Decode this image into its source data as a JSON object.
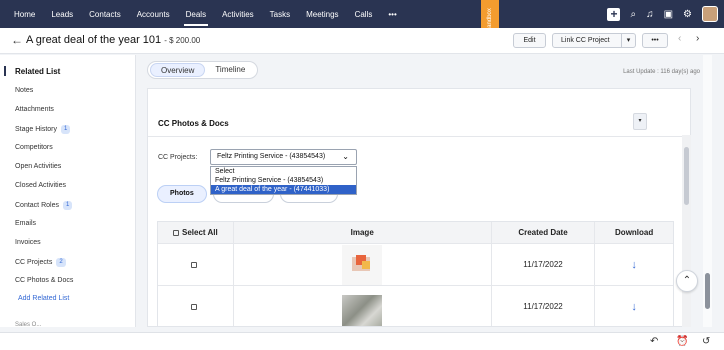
{
  "nav": {
    "items": [
      "Home",
      "Leads",
      "Contacts",
      "Accounts",
      "Deals",
      "Activities",
      "Tasks",
      "Meetings",
      "Calls",
      "•••"
    ],
    "active": "Deals",
    "sandbox_label": "Sandbox",
    "icons": [
      "plus-icon",
      "search-icon",
      "bell-icon",
      "calendar-icon",
      "gear-icon",
      "avatar"
    ]
  },
  "header": {
    "back": "←",
    "title": "A great deal of the year 101",
    "amount": "- $ 200.00",
    "edit_label": "Edit",
    "link_label": "Link CC Project",
    "link_caret": "▾",
    "more_label": "•••",
    "prev": "‹",
    "next": "›"
  },
  "sidebar": {
    "title": "Related List",
    "items": [
      {
        "label": "Notes",
        "badge": ""
      },
      {
        "label": "Attachments",
        "badge": ""
      },
      {
        "label": "Stage History",
        "badge": "1"
      },
      {
        "label": "Competitors",
        "badge": ""
      },
      {
        "label": "Open Activities",
        "badge": ""
      },
      {
        "label": "Closed Activities",
        "badge": ""
      },
      {
        "label": "Contact Roles",
        "badge": "1"
      },
      {
        "label": "Emails",
        "badge": ""
      },
      {
        "label": "Invoices",
        "badge": ""
      },
      {
        "label": "CC Projects",
        "badge": "2"
      },
      {
        "label": "CC Photos & Docs",
        "badge": ""
      }
    ],
    "add_label": "Add Related List",
    "peek_label": "Sales O..."
  },
  "tabs": {
    "items": [
      "Overview",
      "Timeline"
    ],
    "active": "Overview"
  },
  "last_update": "Last Update : 116 day(s) ago",
  "section": {
    "title": "CC Photos & Docs",
    "toggle": "▾",
    "cc_projects_label": "CC Projects:",
    "select_value": "Feltz Printing Service - (43854543)",
    "select_chevron": "⌄",
    "options": [
      "Select",
      "Feltz Printing Service - (43854543)",
      "A great deal of the year - (47441033)"
    ],
    "highlighted_option": 2,
    "subtabs": [
      "Photos",
      "Documents",
      "Checklists"
    ]
  },
  "table": {
    "headers": [
      "Select All",
      "Image",
      "Created Date",
      "Download"
    ],
    "rows": [
      {
        "created": "11/17/2022",
        "download": "↓"
      },
      {
        "created": "11/17/2022",
        "download": "↓"
      }
    ]
  },
  "scroll_up": "⌃",
  "bottom_icons": [
    "undo-icon",
    "alarm-icon",
    "history-icon"
  ]
}
